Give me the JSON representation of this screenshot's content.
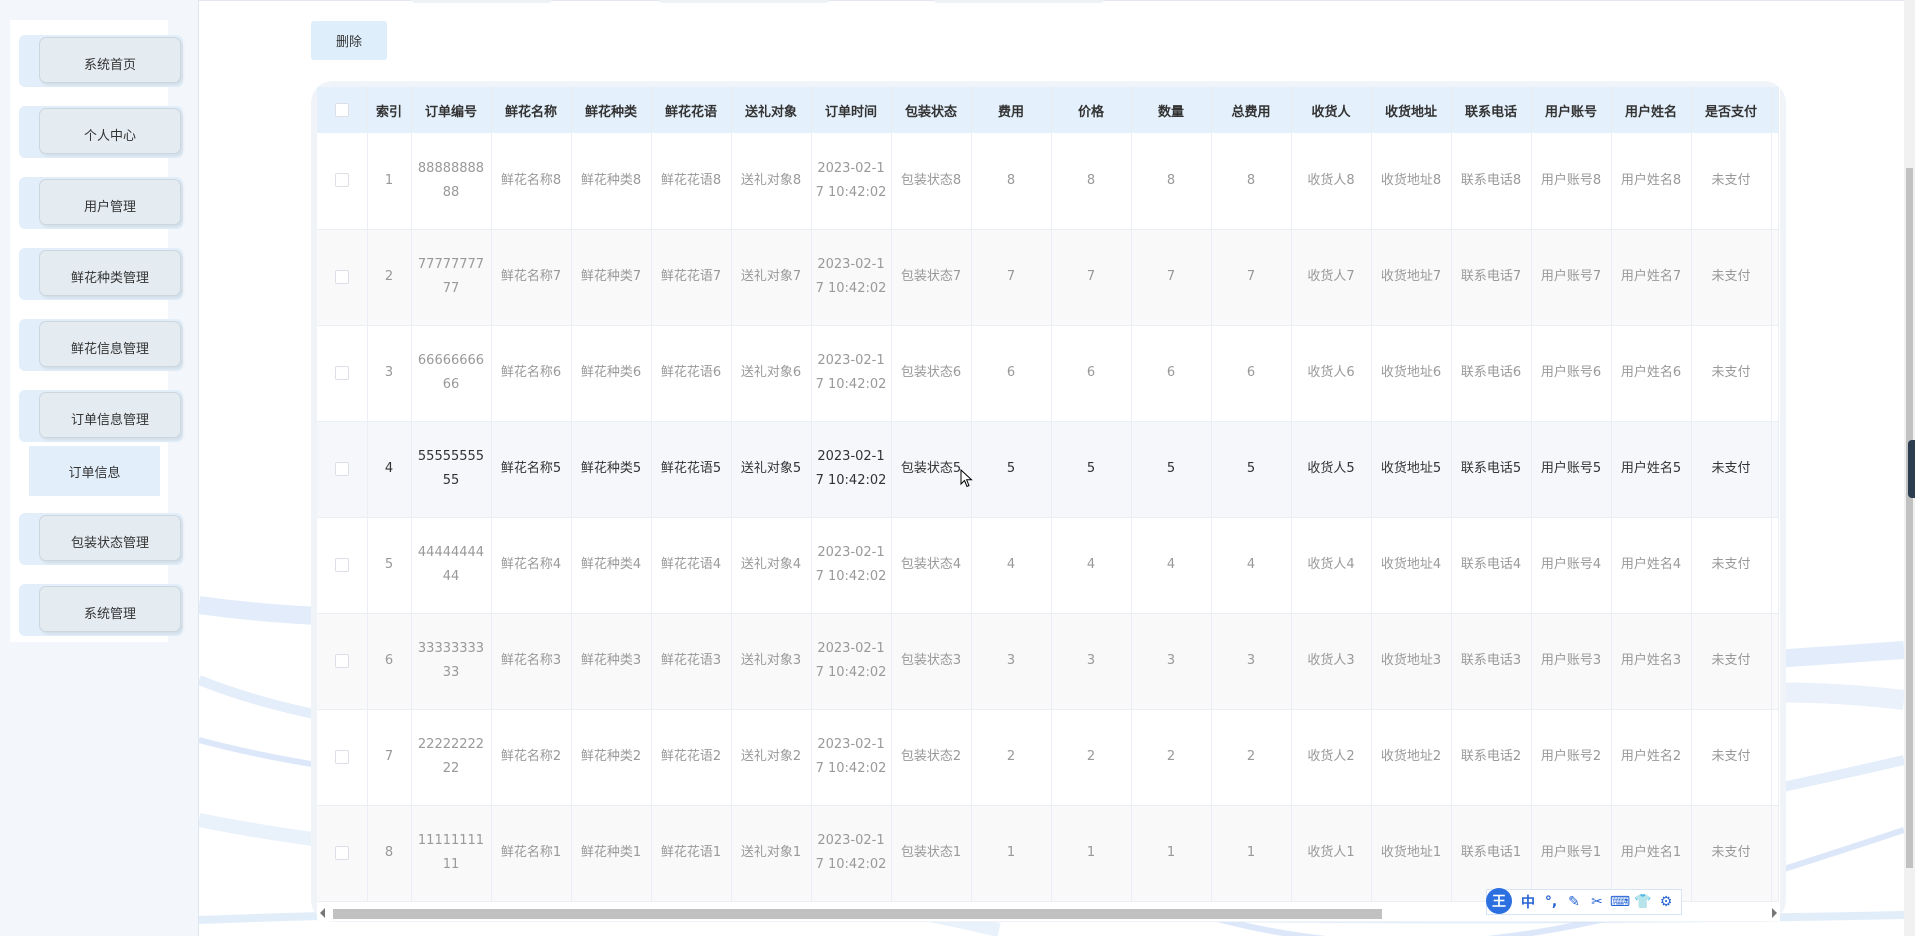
{
  "sidebar": {
    "items": [
      {
        "label": "系统首页"
      },
      {
        "label": "个人中心"
      },
      {
        "label": "用户管理"
      },
      {
        "label": "鲜花种类管理"
      },
      {
        "label": "鲜花信息管理"
      },
      {
        "label": "订单信息管理"
      },
      {
        "label": "包装状态管理"
      },
      {
        "label": "系统管理"
      }
    ],
    "submenu": {
      "label": "订单信息"
    }
  },
  "toolbar": {
    "delete_label": "删除"
  },
  "table": {
    "columns": [
      "索引",
      "订单编号",
      "鲜花名称",
      "鲜花种类",
      "鲜花花语",
      "送礼对象",
      "订单时间",
      "包装状态",
      "费用",
      "价格",
      "数量",
      "总费用",
      "收货人",
      "收货地址",
      "联系电话",
      "用户账号",
      "用户姓名",
      "是否支付"
    ],
    "rows": [
      [
        "1",
        "8888888888",
        "鲜花名称8",
        "鲜花种类8",
        "鲜花花语8",
        "送礼对象8",
        "2023-02-17 10:42:02",
        "包装状态8",
        "8",
        "8",
        "8",
        "8",
        "收货人8",
        "收货地址8",
        "联系电话8",
        "用户账号8",
        "用户姓名8",
        "未支付"
      ],
      [
        "2",
        "7777777777",
        "鲜花名称7",
        "鲜花种类7",
        "鲜花花语7",
        "送礼对象7",
        "2023-02-17 10:42:02",
        "包装状态7",
        "7",
        "7",
        "7",
        "7",
        "收货人7",
        "收货地址7",
        "联系电话7",
        "用户账号7",
        "用户姓名7",
        "未支付"
      ],
      [
        "3",
        "6666666666",
        "鲜花名称6",
        "鲜花种类6",
        "鲜花花语6",
        "送礼对象6",
        "2023-02-17 10:42:02",
        "包装状态6",
        "6",
        "6",
        "6",
        "6",
        "收货人6",
        "收货地址6",
        "联系电话6",
        "用户账号6",
        "用户姓名6",
        "未支付"
      ],
      [
        "4",
        "5555555555",
        "鲜花名称5",
        "鲜花种类5",
        "鲜花花语5",
        "送礼对象5",
        "2023-02-17 10:42:02",
        "包装状态5",
        "5",
        "5",
        "5",
        "5",
        "收货人5",
        "收货地址5",
        "联系电话5",
        "用户账号5",
        "用户姓名5",
        "未支付"
      ],
      [
        "5",
        "4444444444",
        "鲜花名称4",
        "鲜花种类4",
        "鲜花花语4",
        "送礼对象4",
        "2023-02-17 10:42:02",
        "包装状态4",
        "4",
        "4",
        "4",
        "4",
        "收货人4",
        "收货地址4",
        "联系电话4",
        "用户账号4",
        "用户姓名4",
        "未支付"
      ],
      [
        "6",
        "3333333333",
        "鲜花名称3",
        "鲜花种类3",
        "鲜花花语3",
        "送礼对象3",
        "2023-02-17 10:42:02",
        "包装状态3",
        "3",
        "3",
        "3",
        "3",
        "收货人3",
        "收货地址3",
        "联系电话3",
        "用户账号3",
        "用户姓名3",
        "未支付"
      ],
      [
        "7",
        "2222222222",
        "鲜花名称2",
        "鲜花种类2",
        "鲜花花语2",
        "送礼对象2",
        "2023-02-17 10:42:02",
        "包装状态2",
        "2",
        "2",
        "2",
        "2",
        "收货人2",
        "收货地址2",
        "联系电话2",
        "用户账号2",
        "用户姓名2",
        "未支付"
      ],
      [
        "8",
        "1111111111",
        "鲜花名称1",
        "鲜花种类1",
        "鲜花花语1",
        "送礼对象1",
        "2023-02-17 10:42:02",
        "包装状态1",
        "1",
        "1",
        "1",
        "1",
        "收货人1",
        "收货地址1",
        "联系电话1",
        "用户账号1",
        "用户姓名1",
        "未支付"
      ]
    ],
    "hovered_row": 3
  },
  "ime": {
    "logo": "王",
    "buttons": [
      {
        "text": "中",
        "icon": "chinese-mode-icon"
      },
      {
        "text": "°,",
        "icon": "punctuation-icon"
      },
      {
        "text": "✎",
        "icon": "handwriting-icon"
      },
      {
        "text": "✂",
        "icon": "screenshot-icon"
      },
      {
        "text": "⌨",
        "icon": "keyboard-icon"
      },
      {
        "text": "👕",
        "icon": "skin-icon"
      },
      {
        "text": "⚙",
        "icon": "settings-icon"
      }
    ]
  },
  "colors": {
    "accent_light": "#dfeefb",
    "header_bg": "#e4f0fb",
    "ime_blue": "#2b6fe0"
  }
}
